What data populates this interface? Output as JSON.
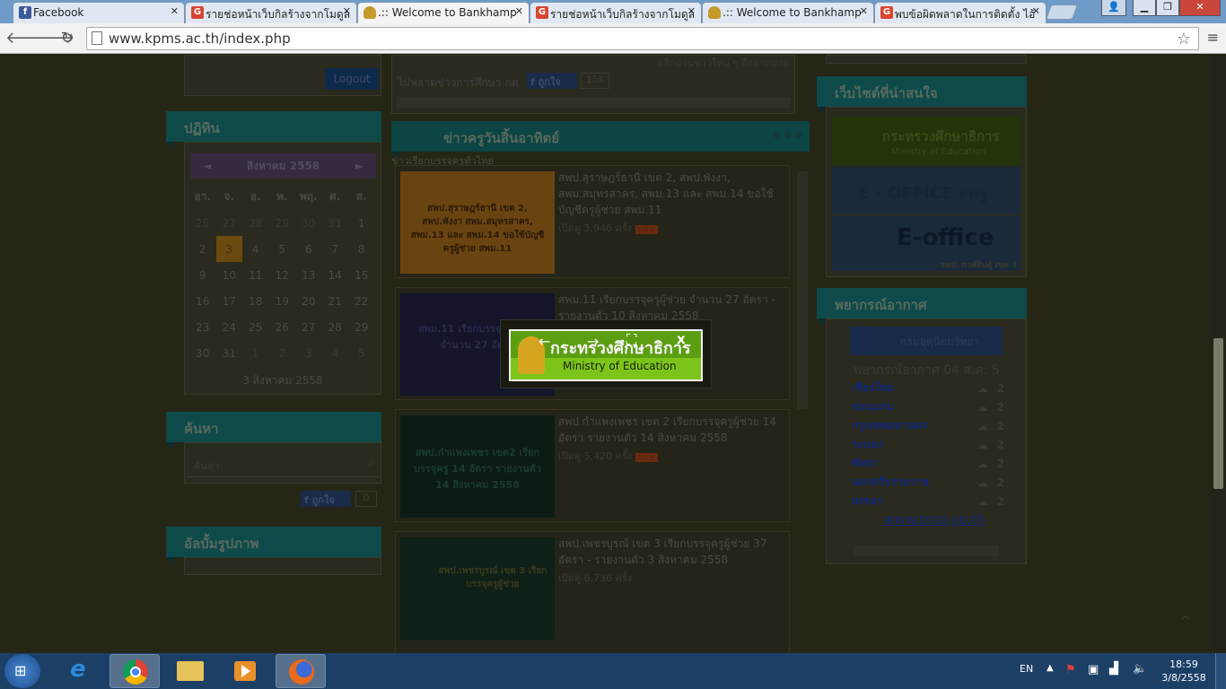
{
  "browser": {
    "tabs": [
      {
        "title": "Facebook",
        "favicon": "facebook-icon",
        "active": false
      },
      {
        "title": "รายช่อหน้าเว็บกิลร้างจากโมดูล",
        "favicon": "google-icon",
        "active": false
      },
      {
        "title": ".:: Welcome to Bankhamp",
        "favicon": "school-seal-icon",
        "active": true
      },
      {
        "title": "รายช่อหน้าเว็บกิลร้างจากโมดูล",
        "favicon": "google-icon",
        "active": false
      },
      {
        "title": ".:: Welcome to Bankhamp",
        "favicon": "school-seal-icon",
        "active": false
      },
      {
        "title": "พบข้อผิดพลาดในการติดตั้ง ไอ้",
        "favicon": "google-icon",
        "active": false
      }
    ],
    "url": "www.kpms.ac.th/index.php"
  },
  "sidebar": {
    "logout_label": "Logout",
    "calendar_title": "ปฏิทิน",
    "calendar_month": "สิงหาคม 2558",
    "calendar_prev": "◄",
    "calendar_next": "►",
    "weekdays": [
      "อา.",
      "จ.",
      "อ.",
      "พ.",
      "พฤ.",
      "ศ.",
      "ส."
    ],
    "calendar_weeks": [
      [
        "26",
        "27",
        "28",
        "29",
        "30",
        "31",
        "1"
      ],
      [
        "2",
        "3",
        "4",
        "5",
        "6",
        "7",
        "8"
      ],
      [
        "9",
        "10",
        "11",
        "12",
        "13",
        "14",
        "15"
      ],
      [
        "16",
        "17",
        "18",
        "19",
        "20",
        "21",
        "22"
      ],
      [
        "23",
        "24",
        "25",
        "26",
        "27",
        "28",
        "29"
      ],
      [
        "30",
        "31",
        "1",
        "2",
        "3",
        "4",
        "5"
      ]
    ],
    "calendar_today": "3",
    "calendar_date_caption": "3 สิงหาคม 2558",
    "search_title": "ค้นหา",
    "search_placeholder": "ค้นหา",
    "like_label": "ถูกใจ",
    "like_count": "0",
    "album_title": "อัลบั้มรูปภาพ"
  },
  "main": {
    "top_link": "คลิกอ่านข่าวใหม่ ๆ อีกมากมาย",
    "ticker_text": "ไม่พลาดข่าวการศึกษา กด",
    "like_label": "ถูกใจ",
    "like_count": "15k",
    "section_title": "ข่าวครูวันสิ้นอาทิตย์",
    "section_subtitle": "ข่าวเรียกบรรจุครูทั่วไทย",
    "news": [
      {
        "title": "สพป.สุราษฎร์ธานี เขต 2, สพป.พังงา, สพม.สมุทรสาคร, สพม.13 และ สพม.14 ขอใช้บัญชีครูผู้ช่วย สพม.11",
        "meta": "เปิดดู 3,946 ครั้ง",
        "thumb_text": "สพป.สุราษฎร์ธานี เขต 2, สพป.พังงา สพม.สมุทรสาคร, สพม.13 และ สพม.14 ขอใช้บัญชีครูผู้ช่วย สพม.11",
        "is_new": true
      },
      {
        "title": "สพม.11 เรียกบรรจุครูผู้ช่วย จำนวน 27 อัตรา - รายงานตัว 10 สิงหาคม 2558",
        "meta": "",
        "thumb_text": "สพม.11 เรียกบรรจุครูผู้ช่วย จำนวน 27 อัตรา",
        "is_new": false
      },
      {
        "title": "สพป.กำแพงเพชร เขต 2 เรียกบรรจุครูผู้ช่วย 14 อัตรา รายงานตัว 14 สิงหาคม 2558",
        "meta": "เปิดดู 5,420 ครั้ง",
        "thumb_text": "สพป.กำแพงเพชร เขต2 เรียกบรรจุครู 14 อัตรา รายงานตัว 14 สิงหาคม 2558",
        "is_new": true
      },
      {
        "title": "สพป.เพชรบูรณ์ เขต 3 เรียกบรรจุครูผู้ช่วย 37 อัตรา - รายงานตัว 3 สิงหาคม 2558",
        "meta": "เปิดดู 6,736 ครั้ง",
        "thumb_text": "สพป.เพชรบูรณ์ เขต 3 เรียกบรรจุครูผู้ช่วย",
        "is_new": false
      }
    ]
  },
  "rightbar": {
    "links_title": "เว็บไซต์ที่น่าสนใจ",
    "moe_banner_th": "กระทรวงศึกษาธิการ",
    "moe_banner_en": "Ministry of Education",
    "eoffice_label": "E - OFFICE สพฐ.",
    "eoffice2_label": "E-office",
    "eoffice2_caption": "สพป. กาฬสินธุ์ เขต 3",
    "weather_title": "พยากรณ์อากาศ",
    "weather_banner": "กรมอุตุนิยมวิทยา",
    "weather_heading": "พยากรณ์อากาศ 04 ส.ค. 5",
    "weather_cities": [
      {
        "name": "เชียงใหม่",
        "value": "2"
      },
      {
        "name": "ขอนแก่น",
        "value": "2"
      },
      {
        "name": "กรุงเทพมหานคร",
        "value": "2"
      },
      {
        "name": "ระนอง",
        "value": "2"
      },
      {
        "name": "พัทยา",
        "value": "2"
      },
      {
        "name": "นครศรีธรรมราช",
        "value": "2"
      },
      {
        "name": "สงขลา",
        "value": "2"
      }
    ],
    "weather_link": "www.tmd.go.th"
  },
  "modal": {
    "prev_label": "←",
    "next_label": "→",
    "fullscreen_label": "⛶",
    "close_label": "x",
    "image_text_th": "กระทรวงศึกษาธิการ",
    "image_text_en": "Ministry of Education"
  },
  "taskbar": {
    "language": "EN",
    "time": "18:59",
    "date": "3/8/2558"
  },
  "colors": {
    "ribbon": "#0e4a4a",
    "overlay": "#262616",
    "moe_green": "#5c9e12",
    "taskbar": "#1c3f66"
  }
}
